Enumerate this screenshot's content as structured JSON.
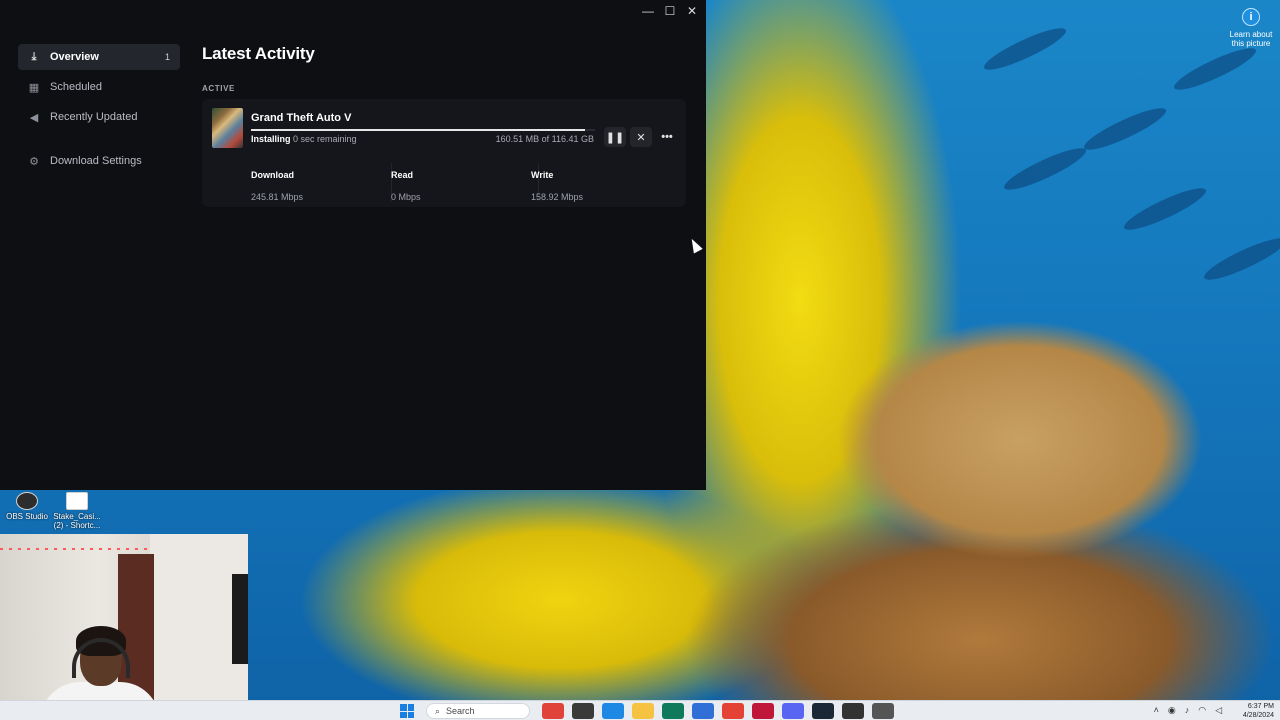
{
  "window": {
    "controls": {
      "minimize": "—",
      "maximize": "☐",
      "close": "✕"
    }
  },
  "sidebar": {
    "items": [
      {
        "label": "Overview",
        "icon": "download-icon",
        "badge": "1",
        "active": true
      },
      {
        "label": "Scheduled",
        "icon": "calendar-icon"
      },
      {
        "label": "Recently Updated",
        "icon": "megaphone-icon"
      },
      {
        "label": "Download Settings",
        "icon": "gear-icon"
      }
    ]
  },
  "main": {
    "title": "Latest Activity",
    "section_label": "ACTIVE",
    "download": {
      "game_title": "Grand Theft Auto V",
      "status": "Installing",
      "remaining": "0 sec remaining",
      "size": "160.51 MB of 116.41 GB",
      "progress": 0.97,
      "stats": [
        {
          "label": "Download",
          "value": "245.81 Mbps"
        },
        {
          "label": "Read",
          "value": "0 Mbps"
        },
        {
          "label": "Write",
          "value": "158.92 Mbps"
        }
      ]
    }
  },
  "desktop": {
    "icons": [
      {
        "label": "OBS Studio"
      },
      {
        "label": "Stake_Casi... (2) - Shortc..."
      }
    ],
    "learn_label": "Learn about this picture"
  },
  "taskbar": {
    "search_placeholder": "Search",
    "time": "6:37 PM",
    "date": "4/28/2024",
    "app_colors": [
      "#e0433a",
      "#3a3a3a",
      "#1e88e5",
      "#f5c242",
      "#0f7a5a",
      "#2f6fd6",
      "#e34234",
      "#c0163a",
      "#5865f2",
      "#1b2838",
      "#333333",
      "#555555"
    ]
  },
  "colors": {
    "window_bg": "#0e0f13",
    "card_bg": "#15161b",
    "sidebar_active_bg": "#24262d",
    "accent_progress": "#e6e6e6"
  }
}
